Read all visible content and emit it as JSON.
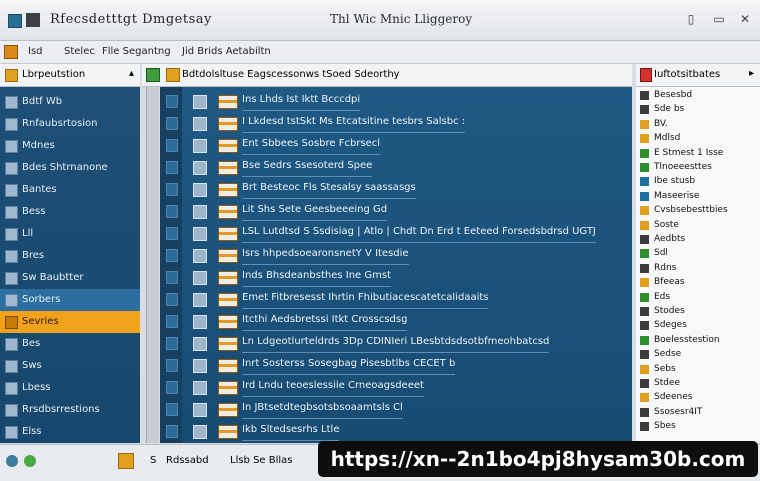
{
  "window": {
    "title": "Rfecsdetttgt Dmgetsay",
    "center_title": "Thl Wic Mnic Lliggeroy",
    "controls": [
      "▯",
      "▭",
      "✕"
    ]
  },
  "menu": {
    "items": [
      "Isd",
      "Stelec",
      "Flle Segantng",
      "Jid Brids Aetabiltn"
    ]
  },
  "sidebar": {
    "header": "Lbrpeutstion",
    "items": [
      {
        "label": "Bdtf Wb"
      },
      {
        "label": "Rnfaubsrtosion"
      },
      {
        "label": "Mdnes"
      },
      {
        "label": "Bdes Shtrnanone"
      },
      {
        "label": "Bantes"
      },
      {
        "label": "Bess"
      },
      {
        "label": "Lll"
      },
      {
        "label": "Bres"
      },
      {
        "label": "Sw Baubtter"
      },
      {
        "label": "Sorbers",
        "state": "selected"
      },
      {
        "label": "Sevries",
        "state": "active"
      },
      {
        "label": "Bes"
      },
      {
        "label": "Sws"
      },
      {
        "label": "Lbess"
      },
      {
        "label": "Rrsdbsrrestions"
      },
      {
        "label": "Elss"
      }
    ]
  },
  "main": {
    "header": "Bdtdolsltuse Eagscessonws  tSoed Sdeorthy",
    "rows": [
      {
        "text": "Ins Lhds  Ist Iktt Bcccdpi"
      },
      {
        "text": "I  Lkdesd  tstSkt  Ms Etcatsitine tesbrs Salsbc  :"
      },
      {
        "text": "Ent Sbbees Sosbre  Fcbrsecl"
      },
      {
        "text": "Bse  Sedrs Ssesoterd  Spee"
      },
      {
        "text": "Brt Besteoc  Fls Stesalsy saassasgs"
      },
      {
        "text": "Lit  Shs  Sete  Geesbeeeing  Gd"
      },
      {
        "text": "LSL Lutdtsd  S  Ssdisiag | Atlo  |  Chdt  Dn  Erd  t Eeteed Forsedsbdrsd  UGTJ"
      },
      {
        "text": "Isrs  hhpedsoearonsnetY  V Itesdie"
      },
      {
        "text": "Inds Bhsdeanbsthes Ine  Gmst"
      },
      {
        "text": "Emet Fitbresesst Ihrtin  Fhibutiacescatetcalidaaits"
      },
      {
        "text": "Itcthi Aedsbretssi Itkt  Crosscsdsg"
      },
      {
        "text": "Ln  Ldgeotlurteldrds  3Dp  CDINIeri LBesbtdsdsotbfmeohbatcsd"
      },
      {
        "text": "Inrt  Sosterss Sosegbag   Pisesbtlbs  CECET b"
      },
      {
        "text": "Ird  Lndu teoeslessiie  Crneoagsdeeet"
      },
      {
        "text": "In   JBtsetdtegbsotsbsoaamtsls  Cl"
      },
      {
        "text": "Ikb   Sltedsesrhs  Ltle"
      }
    ]
  },
  "right_panel": {
    "header": "Iuftotsitbates",
    "items": [
      {
        "label": "Besesbd",
        "color": "#3c3c3c"
      },
      {
        "label": "Sde bs",
        "color": "#3c3c3c"
      },
      {
        "label": "BV.",
        "color": "#e0a11f"
      },
      {
        "label": "Mdlsd",
        "color": "#e0a11f"
      },
      {
        "label": "E   Stmest    1 Isse",
        "color": "#2f8f2f"
      },
      {
        "label": "Tlnoeeesttes",
        "color": "#2f8f2f"
      },
      {
        "label": "Ibe stusb",
        "color": "#1f6f9f"
      },
      {
        "label": "Maseerise",
        "color": "#1f6f9f"
      },
      {
        "label": "Cvsbsebesttbies",
        "color": "#e0a11f"
      },
      {
        "label": "Soste",
        "color": "#e0a11f"
      },
      {
        "label": "Aedbts",
        "color": "#3c3c3c"
      },
      {
        "label": "Sdl",
        "color": "#2f8f2f"
      },
      {
        "label": "Rdns",
        "color": "#3c3c3c"
      },
      {
        "label": "Bfeeas",
        "color": "#e0a11f"
      },
      {
        "label": "Eds",
        "color": "#2f8f2f"
      },
      {
        "label": "Stodes",
        "color": "#3c3c3c"
      },
      {
        "label": "Sdeges",
        "color": "#3c3c3c"
      },
      {
        "label": "Boelesstestion",
        "color": "#2f8f2f"
      },
      {
        "label": "Sedse",
        "color": "#3c3c3c"
      },
      {
        "label": "Sebs",
        "color": "#e0a11f"
      },
      {
        "label": "Stdee",
        "color": "#3c3c3c"
      },
      {
        "label": "Sdeenes",
        "color": "#e0a11f"
      },
      {
        "label": "Ssosesr4IT",
        "color": "#3c3c3c"
      },
      {
        "label": "Sbes",
        "color": "#3c3c3c"
      }
    ]
  },
  "statusbar": {
    "label1": "S",
    "label2": "Rdssabd",
    "label3": "Llsb  Se  Bllas"
  },
  "watermark": "https://xn--2n1bo4pj8hysam30b.com"
}
